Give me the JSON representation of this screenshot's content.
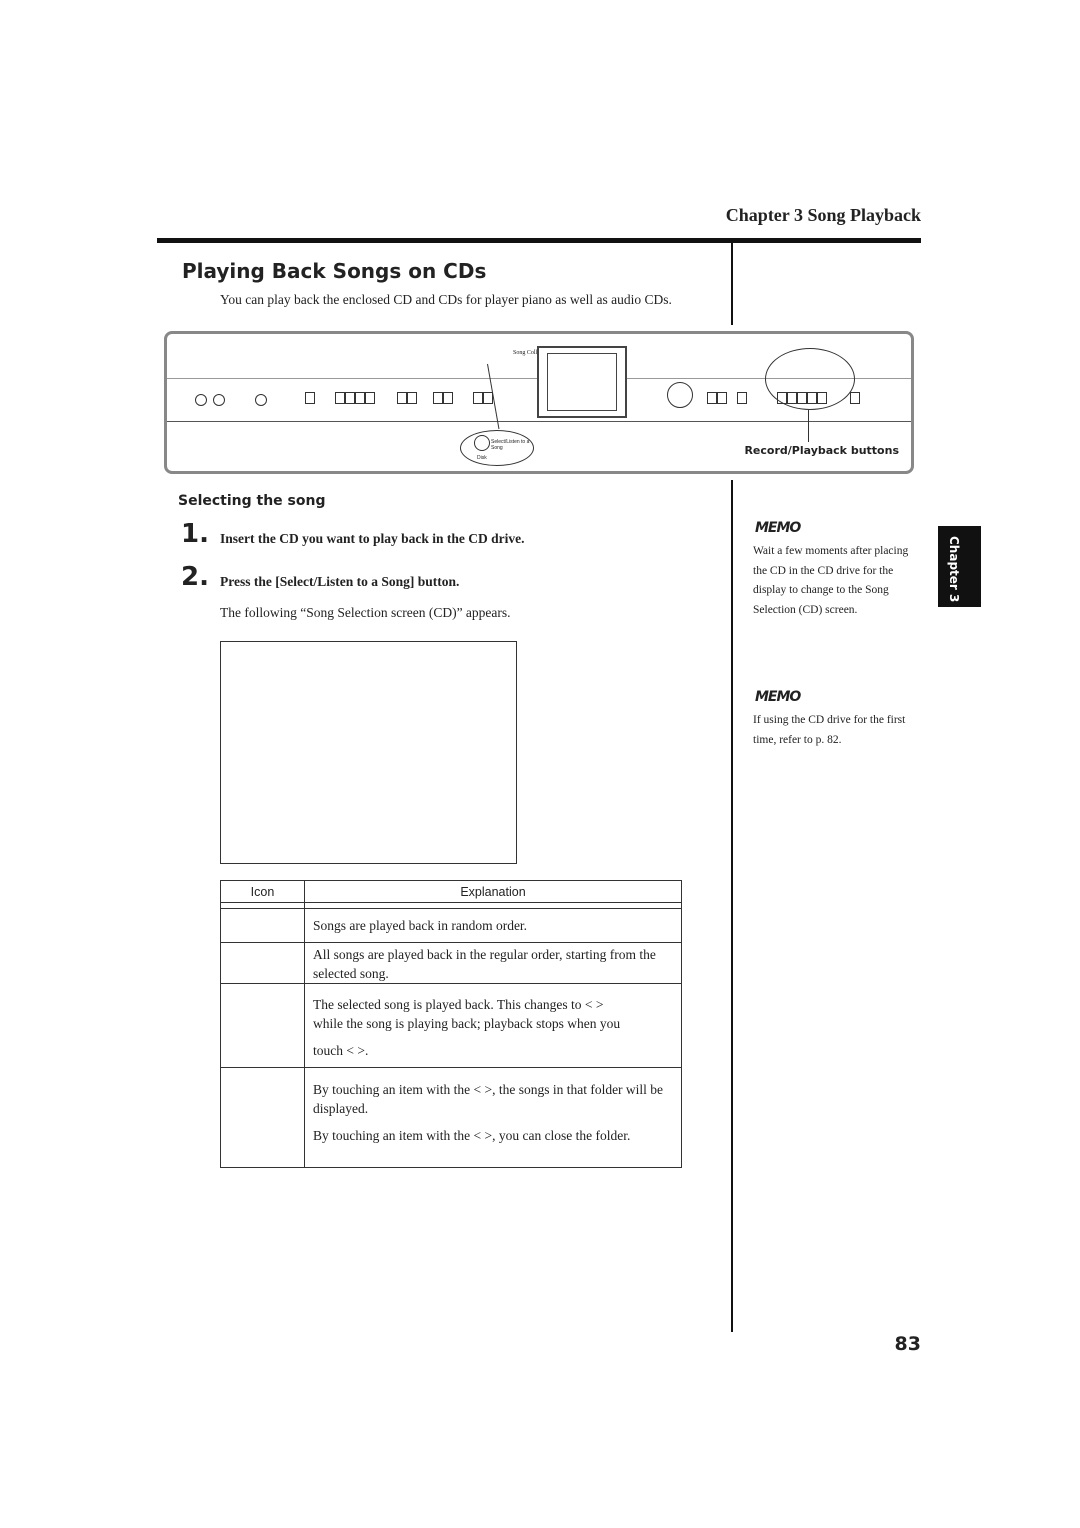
{
  "header": {
    "chapter_title": "Chapter 3 Song Playback"
  },
  "section": {
    "title": "Playing Back Songs on CDs",
    "intro": "You can play back the enclosed CD and CDs for player piano as well as audio CDs."
  },
  "panel": {
    "song_collection": "Song Collection",
    "select_button": "Select/Listen to a Song",
    "disk_label": "Disk",
    "record_playback_label": "Record/Playback buttons"
  },
  "subsection": {
    "title": "Selecting the song"
  },
  "steps": [
    {
      "number": "1.",
      "text": "Insert the CD you want to play back in the CD drive."
    },
    {
      "number": "2.",
      "text": "Press the [Select/Listen to a Song] button."
    }
  ],
  "follow_text": "The following “Song Selection screen (CD)” appears.",
  "memos": [
    {
      "label": "MEMO",
      "text": "Wait a few moments after placing the CD in the CD drive for the display to change to the Song Selection (CD) screen."
    },
    {
      "label": "MEMO",
      "text": "If using the CD drive for the first time, refer to p. 82."
    }
  ],
  "side_tab": "Chapter 3",
  "table": {
    "headers": [
      "Icon",
      "Explanation"
    ],
    "rows": [
      {
        "lines": [
          "Songs are played back in random order."
        ]
      },
      {
        "lines": [
          "All songs are played back in the regular order, starting from the selected song."
        ]
      },
      {
        "lines": [
          "The selected song is played back. This changes to <          >",
          "while the song is playing back; playback stops when you",
          "touch <          >."
        ]
      },
      {
        "lines": [
          "By touching an item with the <          >, the songs in that folder will be displayed.",
          "By touching an item with the <          >, you can close the folder."
        ]
      }
    ]
  },
  "page_number": "83"
}
